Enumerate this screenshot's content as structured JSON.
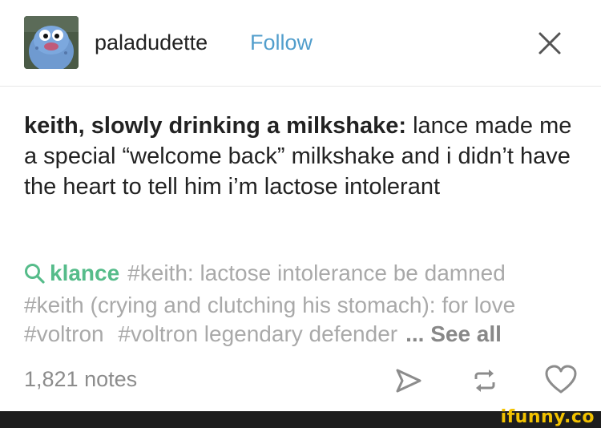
{
  "header": {
    "username": "paladudette",
    "follow_label": "Follow"
  },
  "post": {
    "speaker": "keith, slowly drinking a milkshake:",
    "text": " lance made me a special “welcome back” milkshake and i didn’t have the heart to tell him i’m lactose intolerant"
  },
  "tags": {
    "featured": "klance",
    "items": [
      "#keith: lactose intolerance be damned",
      "#keith (crying and clutching his stomach): for love",
      "#voltron",
      "#voltron legendary defender"
    ],
    "see_all_label": "... See all"
  },
  "footer": {
    "notes": "1,821 notes",
    "brand": "ifunny.co"
  },
  "icons": {
    "search": "search-icon",
    "share": "send-icon",
    "reblog": "reblog-icon",
    "like": "heart-icon",
    "close": "close-icon"
  },
  "colors": {
    "follow": "#529ecc",
    "featured_tag": "#56bc8a",
    "tag": "#a9a9a9",
    "brand": "#f2c200"
  }
}
